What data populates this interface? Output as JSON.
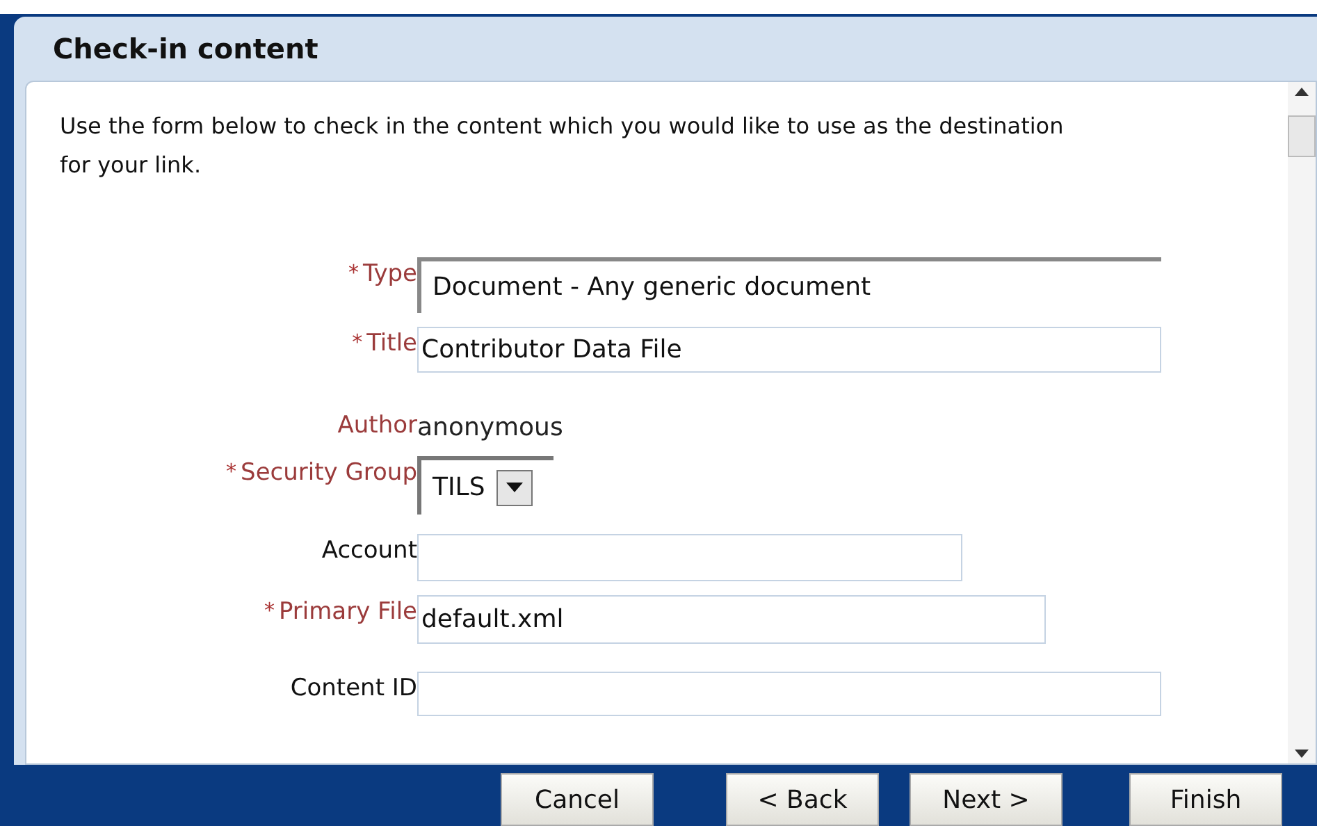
{
  "panel": {
    "title": "Check-in content",
    "intro": "Use the form below to check in the content which you would like to use as the destination for your link."
  },
  "fields": [
    {
      "kind": "combo",
      "label": "Type",
      "required": true,
      "value": "Document - Any generic document"
    },
    {
      "kind": "text",
      "label": "Title",
      "required": true,
      "value": "Contributor Data File"
    },
    {
      "kind": "static",
      "label": "Author",
      "required": false,
      "value": "anonymous"
    },
    {
      "kind": "dropdown",
      "label": "Security Group",
      "required": true,
      "value": "TILS"
    },
    {
      "kind": "text",
      "label": "Account",
      "required": false
    },
    {
      "kind": "text",
      "label": "Primary File",
      "required": true,
      "value": "default.xml"
    },
    {
      "kind": "text",
      "label": "Content ID",
      "required": false
    }
  ],
  "required_mark": "*",
  "buttons": [
    "Cancel",
    "< Back",
    "Next >",
    "Finish"
  ]
}
